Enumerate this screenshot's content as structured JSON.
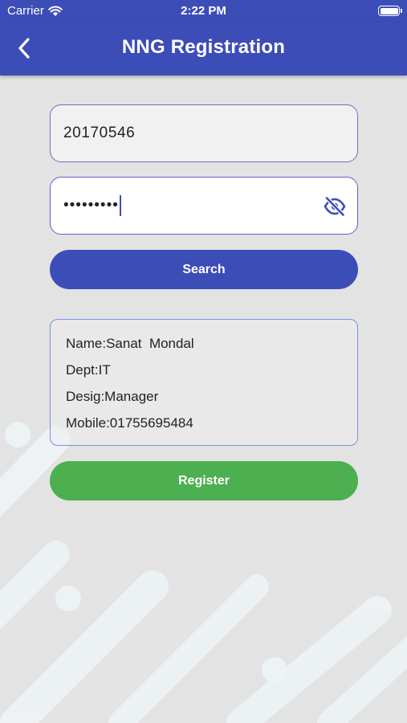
{
  "status_bar": {
    "carrier": "Carrier",
    "time": "2:22 PM"
  },
  "app_bar": {
    "title": "NNG Registration",
    "back_icon": "chevron-left-icon"
  },
  "form": {
    "employee_id_value": "20170546",
    "password_masked": "•••••••••",
    "password_toggle_icon": "eye-slash-icon",
    "search_label": "Search"
  },
  "employee_info": {
    "name": "Name:Sanat  Mondal",
    "dept": "Dept:IT",
    "designation": "Desig:Manager",
    "mobile": "Mobile:01755695484"
  },
  "register_label": "Register",
  "colors": {
    "primary": "#3d4db7",
    "register": "#4caf50",
    "background": "#e3e3e3"
  }
}
